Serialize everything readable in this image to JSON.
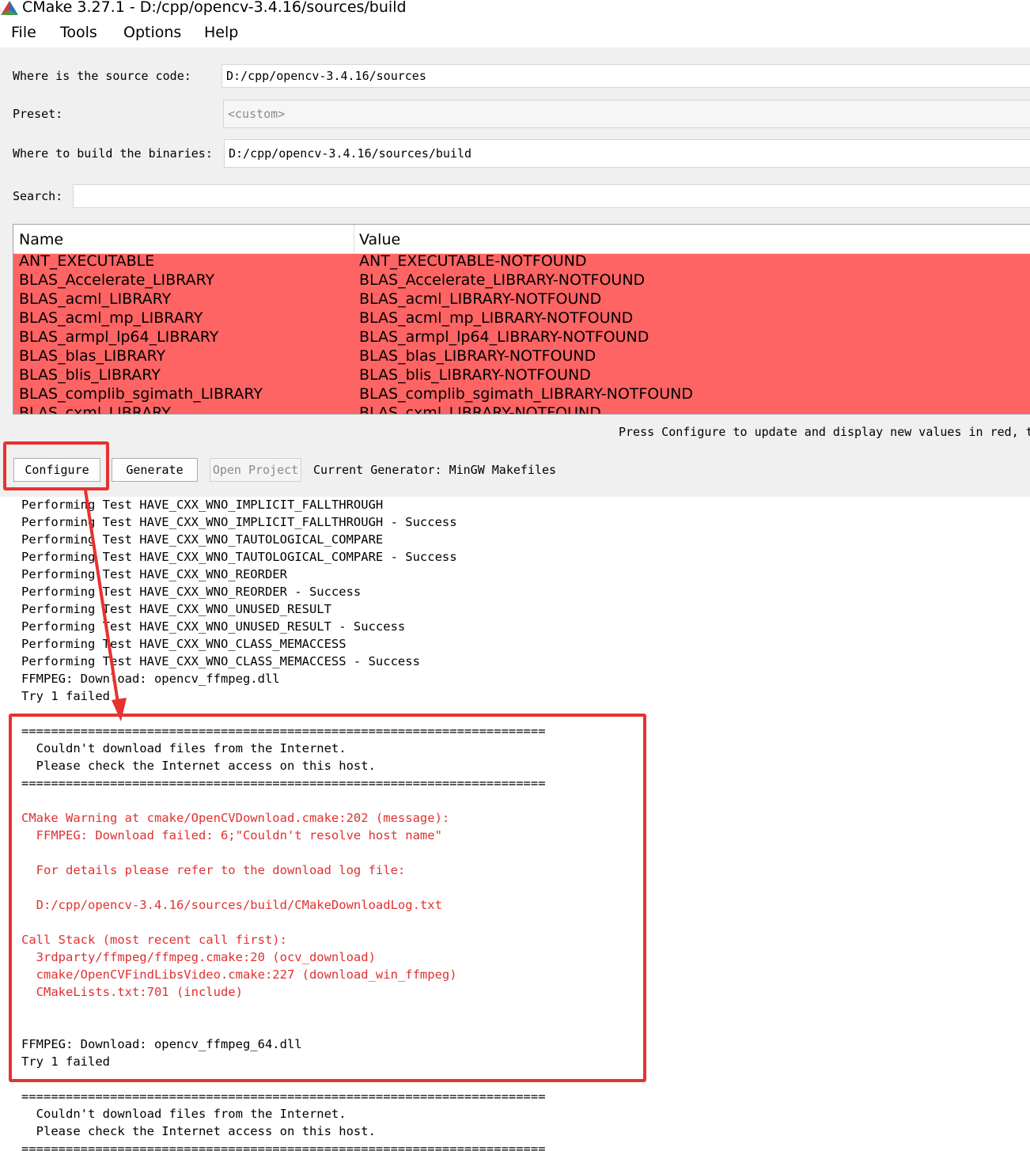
{
  "window": {
    "title": "CMake 3.27.1 - D:/cpp/opencv-3.4.16/sources/build"
  },
  "menu": [
    {
      "label": "File"
    },
    {
      "label": "Tools"
    },
    {
      "label": "Options"
    },
    {
      "label": "Help"
    }
  ],
  "form": {
    "source_label": "Where is the source code:",
    "source_value": "D:/cpp/opencv-3.4.16/sources",
    "preset_label": "Preset:",
    "preset_value": "<custom>",
    "build_label": "Where to build the binaries:",
    "build_value": "D:/cpp/opencv-3.4.16/sources/build",
    "search_label": "Search:",
    "search_value": ""
  },
  "table": {
    "columns": [
      "Name",
      "Value"
    ],
    "rows": [
      {
        "name": "ANT_EXECUTABLE",
        "value": "ANT_EXECUTABLE-NOTFOUND"
      },
      {
        "name": "BLAS_Accelerate_LIBRARY",
        "value": "BLAS_Accelerate_LIBRARY-NOTFOUND"
      },
      {
        "name": "BLAS_acml_LIBRARY",
        "value": "BLAS_acml_LIBRARY-NOTFOUND"
      },
      {
        "name": "BLAS_acml_mp_LIBRARY",
        "value": "BLAS_acml_mp_LIBRARY-NOTFOUND"
      },
      {
        "name": "BLAS_armpl_lp64_LIBRARY",
        "value": "BLAS_armpl_lp64_LIBRARY-NOTFOUND"
      },
      {
        "name": "BLAS_blas_LIBRARY",
        "value": "BLAS_blas_LIBRARY-NOTFOUND"
      },
      {
        "name": "BLAS_blis_LIBRARY",
        "value": "BLAS_blis_LIBRARY-NOTFOUND"
      },
      {
        "name": "BLAS_complib_sgimath_LIBRARY",
        "value": "BLAS_complib_sgimath_LIBRARY-NOTFOUND"
      },
      {
        "name": "BLAS_cxml_LIBRARY",
        "value": "BLAS_cxml_LIBRARY-NOTFOUND"
      }
    ],
    "row_color": "#ff6464"
  },
  "hint": "Press Configure to update and display new values in red, t",
  "buttons": {
    "configure": "Configure",
    "generate": "Generate",
    "open_project": "Open Project",
    "current_generator": "Current Generator: MinGW Makefiles"
  },
  "log": [
    {
      "text": "Performing Test HAVE_CXX_WNO_IMPLICIT_FALLTHROUGH",
      "red": false
    },
    {
      "text": "Performing Test HAVE_CXX_WNO_IMPLICIT_FALLTHROUGH - Success",
      "red": false
    },
    {
      "text": "Performing Test HAVE_CXX_WNO_TAUTOLOGICAL_COMPARE",
      "red": false
    },
    {
      "text": "Performing Test HAVE_CXX_WNO_TAUTOLOGICAL_COMPARE - Success",
      "red": false
    },
    {
      "text": "Performing Test HAVE_CXX_WNO_REORDER",
      "red": false
    },
    {
      "text": "Performing Test HAVE_CXX_WNO_REORDER - Success",
      "red": false
    },
    {
      "text": "Performing Test HAVE_CXX_WNO_UNUSED_RESULT",
      "red": false
    },
    {
      "text": "Performing Test HAVE_CXX_WNO_UNUSED_RESULT - Success",
      "red": false
    },
    {
      "text": "Performing Test HAVE_CXX_WNO_CLASS_MEMACCESS",
      "red": false
    },
    {
      "text": "Performing Test HAVE_CXX_WNO_CLASS_MEMACCESS - Success",
      "red": false
    },
    {
      "text": "FFMPEG: Download: opencv_ffmpeg.dll",
      "red": false
    },
    {
      "text": "Try 1 failed",
      "red": false
    },
    {
      "text": "",
      "red": false
    },
    {
      "text": "=======================================================================",
      "red": false
    },
    {
      "text": "  Couldn't download files from the Internet.",
      "red": false
    },
    {
      "text": "  Please check the Internet access on this host.",
      "red": false
    },
    {
      "text": "=======================================================================",
      "red": false
    },
    {
      "text": "",
      "red": false
    },
    {
      "text": "CMake Warning at cmake/OpenCVDownload.cmake:202 (message):",
      "red": true
    },
    {
      "text": "  FFMPEG: Download failed: 6;\"Couldn't resolve host name\"",
      "red": true
    },
    {
      "text": "",
      "red": true
    },
    {
      "text": "  For details please refer to the download log file:",
      "red": true
    },
    {
      "text": "",
      "red": true
    },
    {
      "text": "  D:/cpp/opencv-3.4.16/sources/build/CMakeDownloadLog.txt",
      "red": true
    },
    {
      "text": "",
      "red": true
    },
    {
      "text": "Call Stack (most recent call first):",
      "red": true
    },
    {
      "text": "  3rdparty/ffmpeg/ffmpeg.cmake:20 (ocv_download)",
      "red": true
    },
    {
      "text": "  cmake/OpenCVFindLibsVideo.cmake:227 (download_win_ffmpeg)",
      "red": true
    },
    {
      "text": "  CMakeLists.txt:701 (include)",
      "red": true
    },
    {
      "text": "",
      "red": false
    },
    {
      "text": "",
      "red": false
    },
    {
      "text": "FFMPEG: Download: opencv_ffmpeg_64.dll",
      "red": false
    },
    {
      "text": "Try 1 failed",
      "red": false
    },
    {
      "text": "",
      "red": false
    },
    {
      "text": "=======================================================================",
      "red": false
    },
    {
      "text": "  Couldn't download files from the Internet.",
      "red": false
    },
    {
      "text": "  Please check the Internet access on this host.",
      "red": false
    },
    {
      "text": "=======================================================================",
      "red": false
    }
  ],
  "colors": {
    "annotation": "#e8322e",
    "log_error": "#e03030",
    "panel_bg": "#f0f0f0"
  }
}
